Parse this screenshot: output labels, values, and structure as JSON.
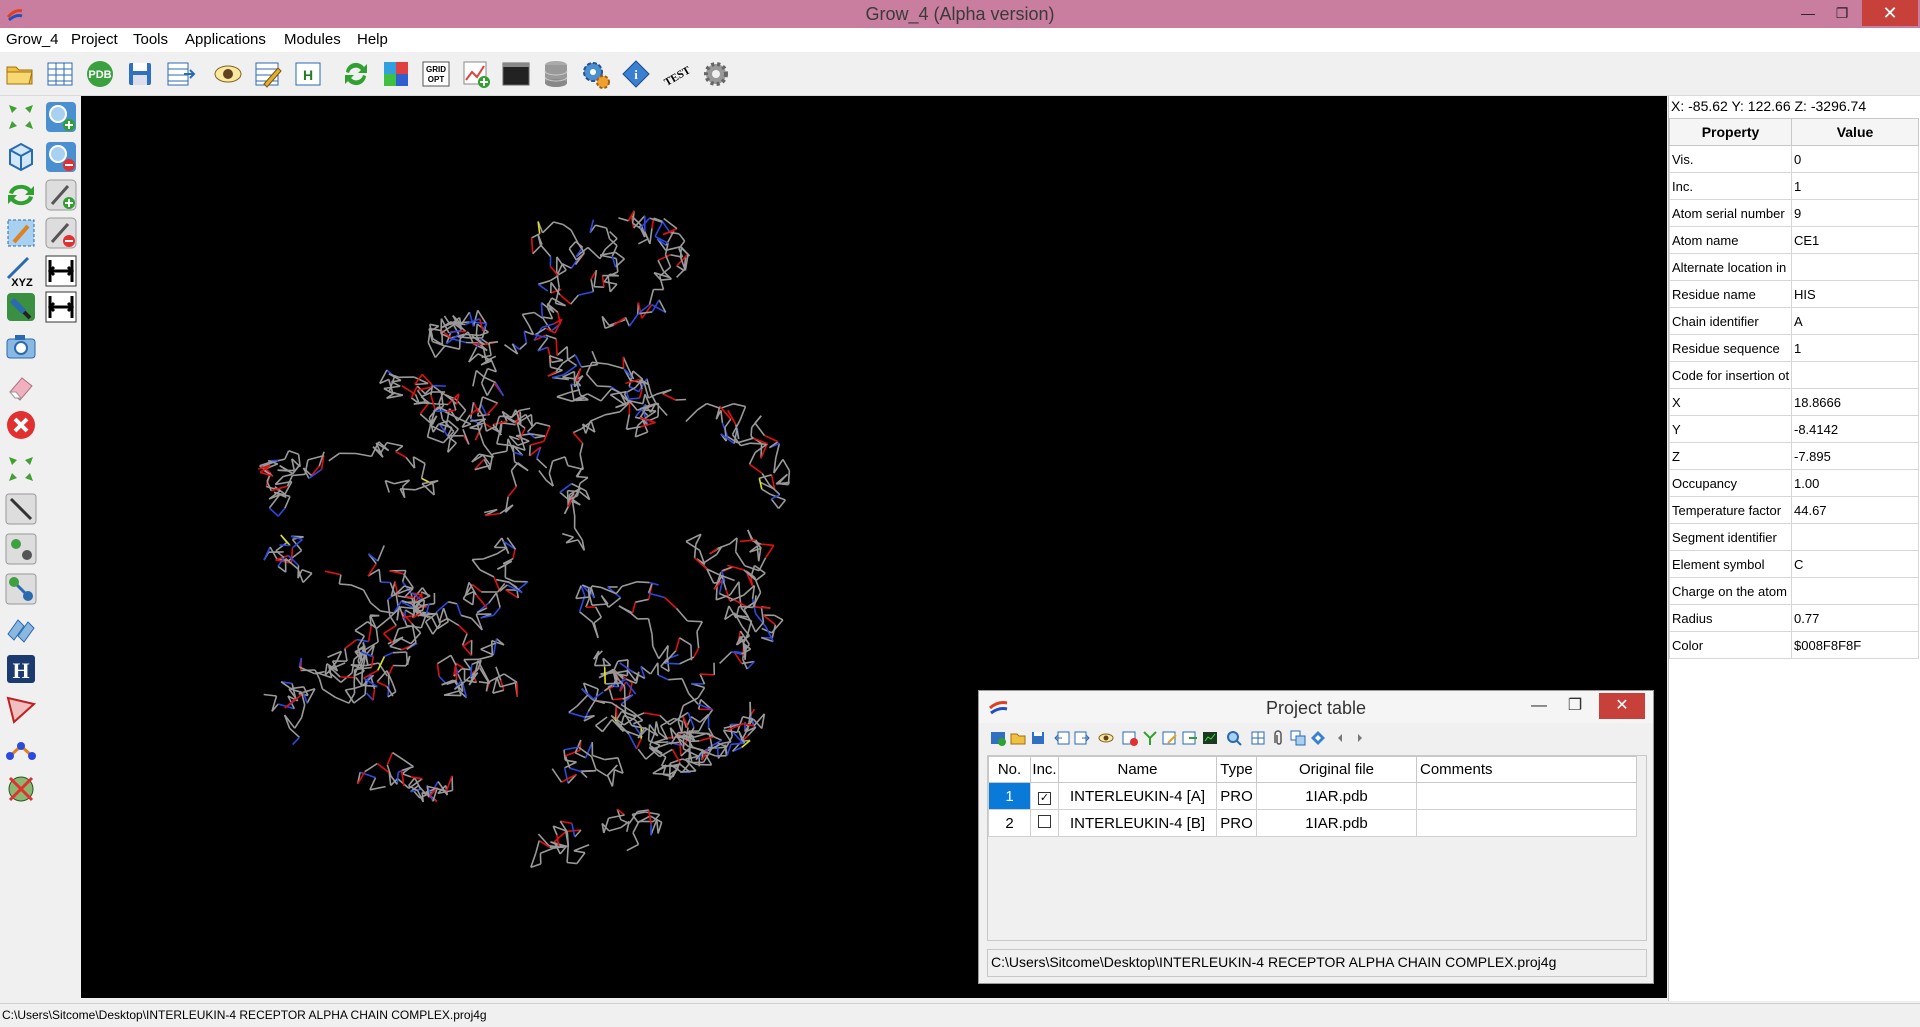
{
  "window": {
    "title": "Grow_4 (Alpha version)",
    "minimize": "—",
    "maximize": "❐",
    "close": "✕"
  },
  "menu": [
    "Grow_4",
    "Project",
    "Tools",
    "Applications",
    "Modules",
    "Help"
  ],
  "toolbar": {
    "pdb_label": "PDB",
    "grid_label": "GRID",
    "opt_label": "OPT",
    "test_label": "TEST"
  },
  "left_tools": {
    "xyz_label": "XYZ",
    "h_label": "H"
  },
  "coords": "X: -85.62 Y: 122.66 Z: -3296.74",
  "properties": {
    "headers": [
      "Property",
      "Value"
    ],
    "rows": [
      [
        "Vis.",
        "0"
      ],
      [
        "Inc.",
        "1"
      ],
      [
        "Atom serial number",
        "9"
      ],
      [
        "Atom name",
        "CE1"
      ],
      [
        "Alternate location in",
        ""
      ],
      [
        "Residue name",
        "HIS"
      ],
      [
        "Chain identifier",
        "A"
      ],
      [
        "Residue sequence",
        "1"
      ],
      [
        "Code for insertion ot",
        ""
      ],
      [
        "X",
        "18.8666"
      ],
      [
        "Y",
        "-8.4142"
      ],
      [
        "Z",
        "-7.895"
      ],
      [
        "Occupancy",
        "1.00"
      ],
      [
        "Temperature factor",
        "44.67"
      ],
      [
        "Segment identifier",
        ""
      ],
      [
        "Element symbol",
        "C"
      ],
      [
        "Charge on the atom",
        ""
      ],
      [
        "Radius",
        "0.77"
      ],
      [
        "Color",
        "$008F8F8F"
      ]
    ]
  },
  "project_table": {
    "title": "Project table",
    "headers": [
      "No.",
      "Inc.",
      "Name",
      "Type",
      "Original file",
      "Comments"
    ],
    "rows": [
      {
        "no": "1",
        "inc": true,
        "name": "INTERLEUKIN-4 [A]",
        "type": "PRO",
        "file": "1IAR.pdb",
        "comments": ""
      },
      {
        "no": "2",
        "inc": false,
        "name": "INTERLEUKIN-4 [B]",
        "type": "PRO",
        "file": "1IAR.pdb",
        "comments": ""
      }
    ],
    "path": "C:\\Users\\Sitcome\\Desktop\\INTERLEUKIN-4 RECEPTOR ALPHA CHAIN COMPLEX.proj4g"
  },
  "status": "C:\\Users\\Sitcome\\Desktop\\INTERLEUKIN-4 RECEPTOR ALPHA CHAIN COMPLEX.proj4g",
  "colors": {
    "titlebar": "#c97e9f",
    "selection": "#0a7ad8",
    "bond_carbon": "#9a9a9a",
    "bond_oxygen": "#e01010",
    "bond_nitrogen": "#2a4ae0",
    "bond_sulfur": "#e0e020"
  }
}
